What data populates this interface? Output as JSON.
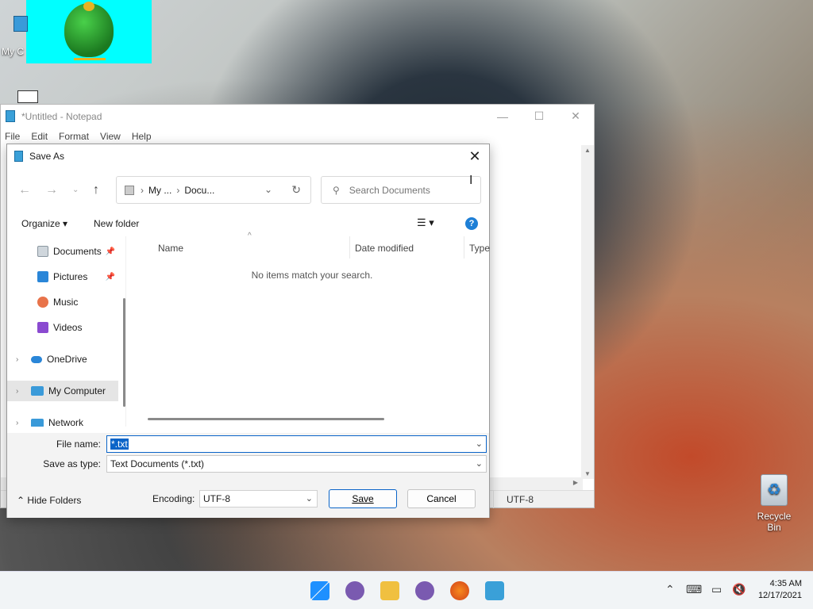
{
  "desktop": {
    "icon_mycomputer": "My C",
    "recycle_bin": "Recycle Bin"
  },
  "notepad": {
    "title": "*Untitled - Notepad",
    "menu": [
      "File",
      "Edit",
      "Format",
      "View",
      "Help"
    ],
    "status_encoding": "UTF-8"
  },
  "dialog": {
    "title": "Save As",
    "breadcrumb": [
      "My ...",
      "Docu..."
    ],
    "search_placeholder": "Search Documents",
    "organize": "Organize",
    "new_folder": "New folder",
    "help": "?",
    "nav": [
      {
        "label": "Documents",
        "pinned": true
      },
      {
        "label": "Pictures",
        "pinned": true
      },
      {
        "label": "Music"
      },
      {
        "label": "Videos"
      },
      {
        "label": "OneDrive"
      },
      {
        "label": "My Computer",
        "selected": true
      },
      {
        "label": "Network"
      }
    ],
    "columns": [
      "Name",
      "Date modified",
      "Type"
    ],
    "empty_message": "No items match your search.",
    "file_name_label": "File name:",
    "file_name_value": "*.txt",
    "save_type_label": "Save as type:",
    "save_type_value": "Text Documents (*.txt)",
    "hide_folders": "Hide Folders",
    "encoding_label": "Encoding:",
    "encoding_value": "UTF-8",
    "save_button": "Save",
    "cancel_button": "Cancel"
  },
  "taskbar": {
    "time": "4:35 AM",
    "date": "12/17/2021"
  }
}
